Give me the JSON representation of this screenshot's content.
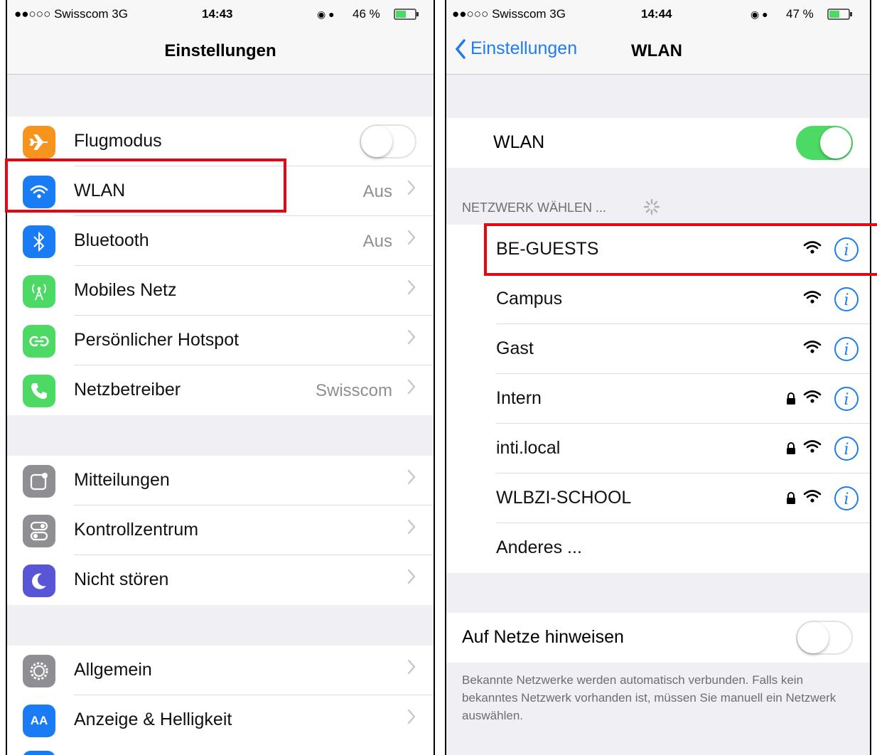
{
  "left": {
    "status": {
      "carrier": "●●○○○ Swisscom 3G",
      "time": "14:43",
      "battery": "46 %"
    },
    "nav_title": "Einstellungen",
    "groups": [
      [
        {
          "label": "Flugmodus",
          "value": "",
          "icon": "airplane-icon",
          "color": "#f7941d",
          "toggle": "off"
        },
        {
          "label": "WLAN",
          "value": "Aus",
          "icon": "wifi-icon",
          "color": "#1a7cf5"
        },
        {
          "label": "Bluetooth",
          "value": "Aus",
          "icon": "bluetooth-icon",
          "color": "#1a7cf5"
        },
        {
          "label": "Mobiles Netz",
          "value": "",
          "icon": "antenna-icon",
          "color": "#4cd964"
        },
        {
          "label": "Persönlicher Hotspot",
          "value": "",
          "icon": "hotspot-icon",
          "color": "#4cd964"
        },
        {
          "label": "Netzbetreiber",
          "value": "Swisscom",
          "icon": "phone-icon",
          "color": "#4cd964"
        }
      ],
      [
        {
          "label": "Mitteilungen",
          "value": "",
          "icon": "notifications-icon",
          "color": "#8e8e93"
        },
        {
          "label": "Kontrollzentrum",
          "value": "",
          "icon": "control-center-icon",
          "color": "#8e8e93"
        },
        {
          "label": "Nicht stören",
          "value": "",
          "icon": "moon-icon",
          "color": "#5856d6"
        }
      ],
      [
        {
          "label": "Allgemein",
          "value": "",
          "icon": "gear-icon",
          "color": "#8e8e93"
        },
        {
          "label": "Anzeige & Helligkeit",
          "value": "",
          "icon": "display-icon",
          "color": "#1a7cf5",
          "glyph": "AA"
        }
      ]
    ]
  },
  "right": {
    "status": {
      "carrier": "●●○○○ Swisscom 3G",
      "time": "14:44",
      "battery": "47 %"
    },
    "back_label": "Einstellungen",
    "nav_title": "WLAN",
    "wlan_label": "WLAN",
    "wlan_toggle": "on",
    "section_header": "NETZWERK WÄHLEN ...",
    "networks": [
      {
        "name": "BE-GUESTS",
        "locked": false
      },
      {
        "name": "Campus",
        "locked": false
      },
      {
        "name": "Gast",
        "locked": false
      },
      {
        "name": "Intern",
        "locked": true
      },
      {
        "name": "inti.local",
        "locked": true
      },
      {
        "name": "WLBZI-SCHOOL",
        "locked": true
      }
    ],
    "other_label": "Anderes ...",
    "ask_label": "Auf Netze hinweisen",
    "ask_toggle": "off",
    "footer": "Bekannte Netzwerke werden automatisch verbunden. Falls kein bekanntes Netzwerk vorhanden ist, müssen Sie manuell ein Netzwerk auswählen."
  },
  "colors": {
    "highlight": "#e8050f",
    "accent": "#1e7cf0",
    "toggle_on": "#4cd964"
  }
}
